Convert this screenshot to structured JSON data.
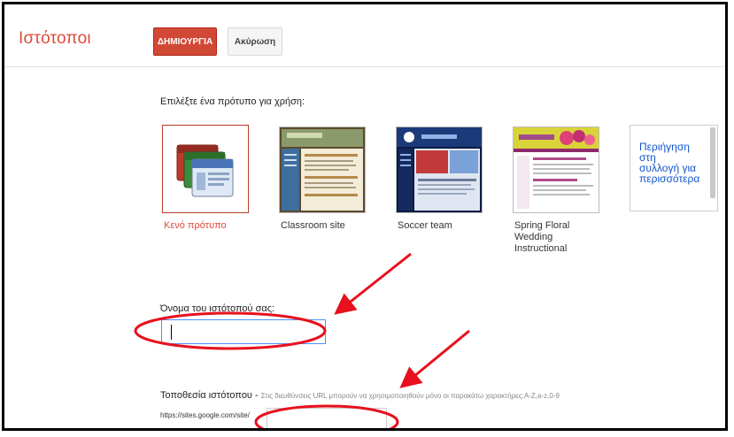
{
  "header": {
    "app_title": "Ιστότοποι",
    "create_label": "ΔΗΜΙΟΥΡΓΙΑ",
    "cancel_label": "Ακύρωση"
  },
  "templates": {
    "prompt": "Επιλέξτε ένα πρότυπο για χρήση:",
    "items": [
      {
        "label": "Κενό πρότυπο"
      },
      {
        "label": "Classroom site"
      },
      {
        "label": "Soccer team"
      },
      {
        "label": "Spring Floral Wedding Instructional"
      }
    ],
    "browse_label": "Περιήγηση στη συλλογή για περισσότερα"
  },
  "site_name": {
    "label": "Όνομα του ιστότοπού σας:",
    "value": ""
  },
  "site_location": {
    "label": "Τοποθεσία ιστότοπου -",
    "hint": "Στις διευθύνσεις URL μπορούν να χρησιμοποιηθούν μόνο οι παρακάτω χαρακτήρες:A-Z,a-z,0-9",
    "url_prefix": "https://sites.google.com/site/",
    "value": ""
  },
  "annotation_color": "#e8101c"
}
